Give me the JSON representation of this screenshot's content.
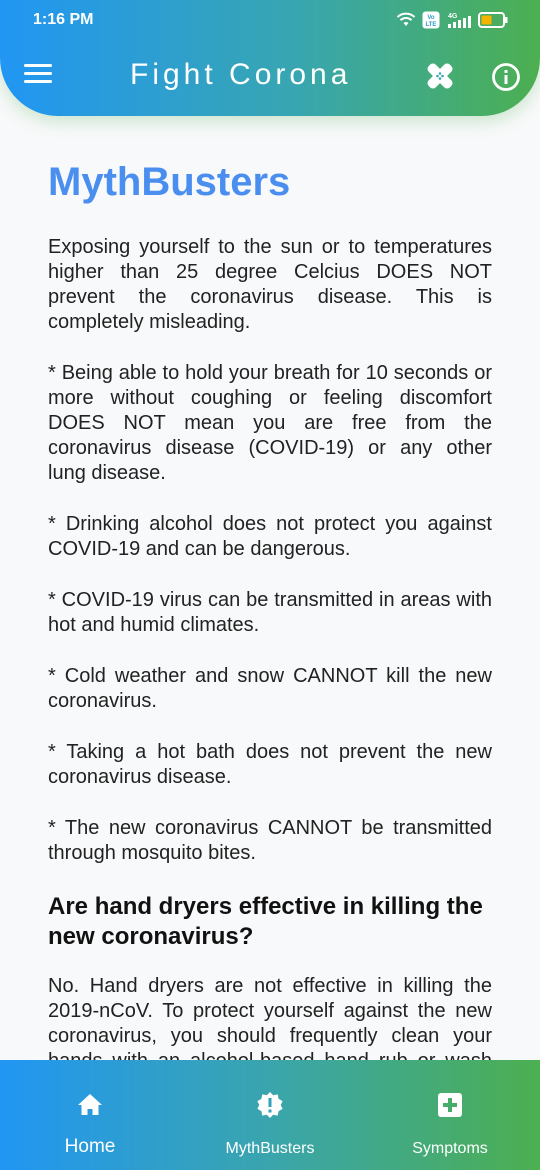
{
  "status_bar": {
    "time": "1:16 PM",
    "icons": [
      "wifi-icon",
      "volte-icon",
      "4g-signal-icon",
      "battery-icon"
    ],
    "network_label": "4G",
    "volte_label": "Vo LTE"
  },
  "app_bar": {
    "title": "Fight Corona",
    "icons": [
      "menu-icon",
      "bandage-icon",
      "info-icon"
    ]
  },
  "content": {
    "title": "MythBusters",
    "paragraphs": [
      "Exposing yourself to the sun or to temperatures higher than 25 degree Celcius DOES NOT prevent the coronavirus disease. This is completely misleading.",
      "* Being able to hold your breath for 10 seconds or more without coughing or feeling discomfort DOES NOT mean you are free from the coronavirus disease (COVID-19) or any other lung disease.",
      "* Drinking alcohol does not protect you against COVID-19 and can be dangerous.",
      "* COVID-19 virus can be transmitted in areas with hot and humid climates.",
      "* Cold weather and snow CANNOT kill the new coronavirus.",
      "* Taking a hot bath does not prevent the new coronavirus disease.",
      "* The new coronavirus CANNOT be transmitted through mosquito bites."
    ],
    "subheading": "Are hand dryers effective in killing the new coronavirus?",
    "answer": "No. Hand dryers are not effective in killing the 2019-nCoV. To protect yourself against the new coronavirus, you should frequently clean your hands with an alcohol-based hand rub or wash them with soap and water."
  },
  "bottom_nav": {
    "items": [
      {
        "label": "Home",
        "icon": "home-icon"
      },
      {
        "label": "MythBusters",
        "icon": "alert-badge-icon"
      },
      {
        "label": "Symptoms",
        "icon": "medical-cross-icon"
      }
    ]
  },
  "colors": {
    "gradient_start": "#2196f3",
    "gradient_end": "#4caf50",
    "title_blue": "#4a8ef0"
  }
}
